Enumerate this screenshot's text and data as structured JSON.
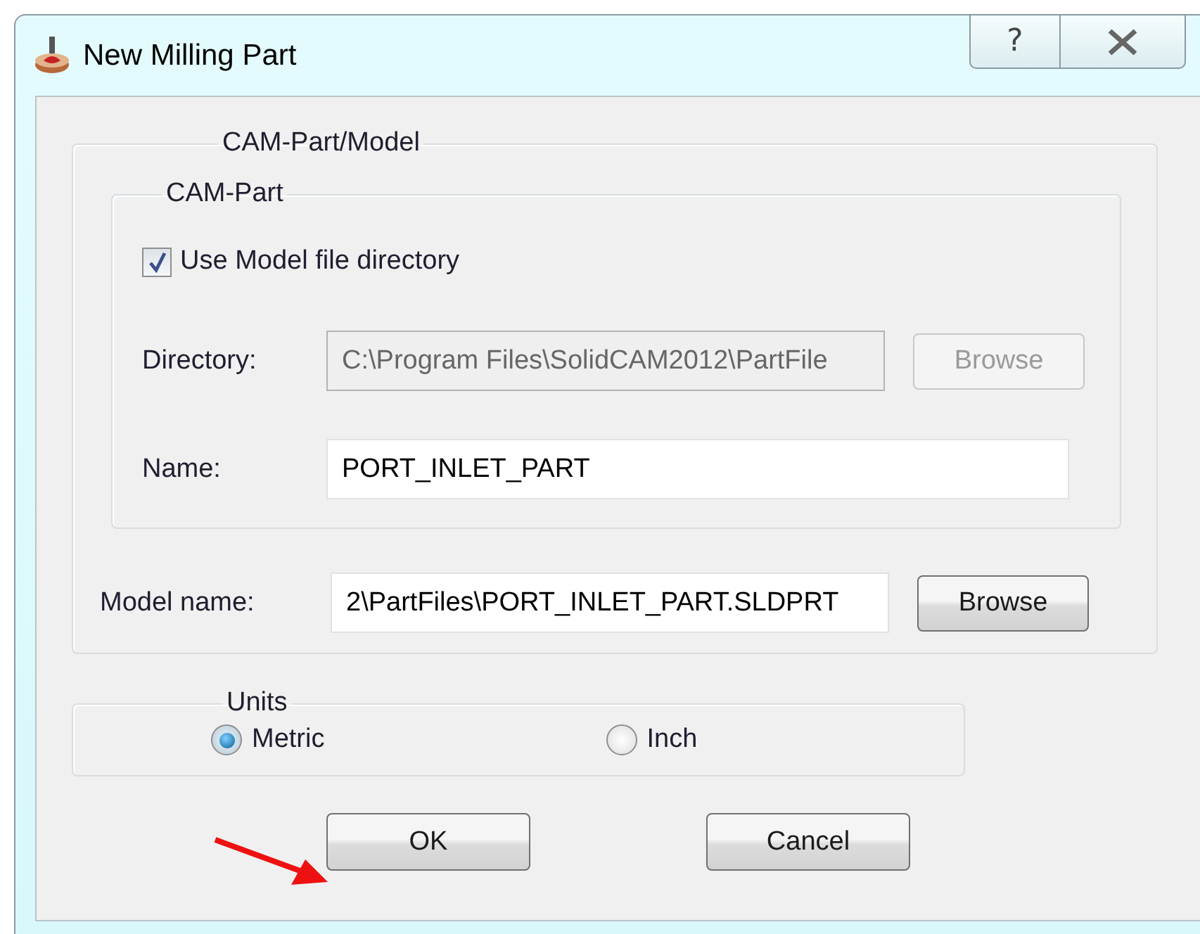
{
  "window": {
    "title": "New Milling Part",
    "help_button": "?"
  },
  "cam_part_model": {
    "legend": "CAM-Part/Model",
    "cam_part": {
      "legend": "CAM-Part",
      "use_model_dir": {
        "label": "Use Model file directory",
        "checked": true
      },
      "directory": {
        "label": "Directory:",
        "value": "C:\\Program Files\\SolidCAM2012\\PartFile",
        "disabled": true,
        "browse": {
          "label": "Browse",
          "disabled": true
        }
      },
      "name": {
        "label": "Name:",
        "value": "PORT_INLET_PART"
      }
    },
    "model_name": {
      "label": "Model name:",
      "value": "2\\PartFiles\\PORT_INLET_PART.SLDPRT",
      "browse": {
        "label": "Browse",
        "disabled": false
      }
    }
  },
  "units": {
    "legend": "Units",
    "options": [
      {
        "label": "Metric",
        "selected": true
      },
      {
        "label": "Inch",
        "selected": false
      }
    ]
  },
  "buttons": [
    "OK",
    "Cancel"
  ]
}
